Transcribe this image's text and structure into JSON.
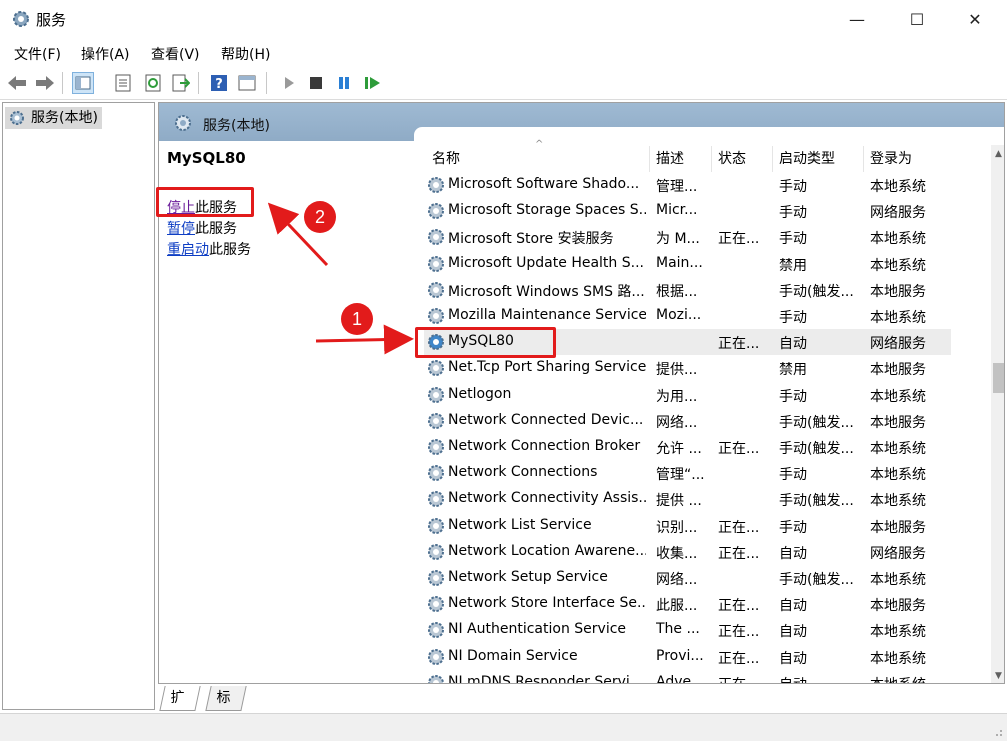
{
  "window": {
    "title": "服务",
    "minimize_glyph": "—",
    "maximize_glyph": "☐",
    "close_glyph": "✕"
  },
  "menu": [
    "文件(F)",
    "操作(A)",
    "查看(V)",
    "帮助(H)"
  ],
  "toolbar_icons": [
    "back-arrow-icon",
    "forward-arrow-icon",
    "console-tree-icon",
    "properties-icon",
    "refresh-icon",
    "export-list-icon",
    "help-icon",
    "show-hide-icon",
    "start-service-icon",
    "stop-service-icon",
    "pause-service-icon",
    "restart-service-icon"
  ],
  "tree": {
    "root_label": "服务(本地)"
  },
  "header": {
    "title": "服务(本地)"
  },
  "detail": {
    "service_name": "MySQL80",
    "actions": [
      {
        "link": "停止",
        "suffix": "此服务"
      },
      {
        "link": "暂停",
        "suffix": "此服务"
      },
      {
        "link": "重启动",
        "suffix": "此服务"
      }
    ]
  },
  "columns": [
    "名称",
    "描述",
    "状态",
    "启动类型",
    "登录为"
  ],
  "services": [
    {
      "name": "Microsoft Software Shado...",
      "desc": "管理...",
      "status": "",
      "startup": "手动",
      "logon": "本地系统"
    },
    {
      "name": "Microsoft Storage Spaces S...",
      "desc": "Micr...",
      "status": "",
      "startup": "手动",
      "logon": "网络服务"
    },
    {
      "name": "Microsoft Store 安装服务",
      "desc": "为 M...",
      "status": "正在...",
      "startup": "手动",
      "logon": "本地系统"
    },
    {
      "name": "Microsoft Update Health S...",
      "desc": "Main...",
      "status": "",
      "startup": "禁用",
      "logon": "本地系统"
    },
    {
      "name": "Microsoft Windows SMS 路...",
      "desc": "根据...",
      "status": "",
      "startup": "手动(触发...",
      "logon": "本地服务"
    },
    {
      "name": "Mozilla Maintenance Service",
      "desc": "Mozi...",
      "status": "",
      "startup": "手动",
      "logon": "本地系统"
    },
    {
      "name": "MySQL80",
      "desc": "",
      "status": "正在...",
      "startup": "自动",
      "logon": "网络服务"
    },
    {
      "name": "Net.Tcp Port Sharing Service",
      "desc": "提供...",
      "status": "",
      "startup": "禁用",
      "logon": "本地服务"
    },
    {
      "name": "Netlogon",
      "desc": "为用...",
      "status": "",
      "startup": "手动",
      "logon": "本地系统"
    },
    {
      "name": "Network Connected Devic...",
      "desc": "网络...",
      "status": "",
      "startup": "手动(触发...",
      "logon": "本地服务"
    },
    {
      "name": "Network Connection Broker",
      "desc": "允许 ...",
      "status": "正在...",
      "startup": "手动(触发...",
      "logon": "本地系统"
    },
    {
      "name": "Network Connections",
      "desc": "管理“...",
      "status": "",
      "startup": "手动",
      "logon": "本地系统"
    },
    {
      "name": "Network Connectivity Assis...",
      "desc": "提供 ...",
      "status": "",
      "startup": "手动(触发...",
      "logon": "本地系统"
    },
    {
      "name": "Network List Service",
      "desc": "识别...",
      "status": "正在...",
      "startup": "手动",
      "logon": "本地服务"
    },
    {
      "name": "Network Location Awarene...",
      "desc": "收集...",
      "status": "正在...",
      "startup": "自动",
      "logon": "网络服务"
    },
    {
      "name": "Network Setup Service",
      "desc": "网络...",
      "status": "",
      "startup": "手动(触发...",
      "logon": "本地系统"
    },
    {
      "name": "Network Store Interface Se...",
      "desc": "此服...",
      "status": "正在...",
      "startup": "自动",
      "logon": "本地服务"
    },
    {
      "name": "NI Authentication Service",
      "desc": "The ...",
      "status": "正在...",
      "startup": "自动",
      "logon": "本地系统"
    },
    {
      "name": "NI Domain Service",
      "desc": "Provi...",
      "status": "正在...",
      "startup": "自动",
      "logon": "本地系统"
    },
    {
      "name": "NI mDNS Responder Servi...",
      "desc": "Adve...",
      "status": "正在...",
      "startup": "自动",
      "logon": "本地系统"
    }
  ],
  "tabs": [
    "扩展",
    "标准"
  ],
  "annotations": {
    "badge1": "1",
    "badge2": "2",
    "color": "#e21b1b"
  }
}
